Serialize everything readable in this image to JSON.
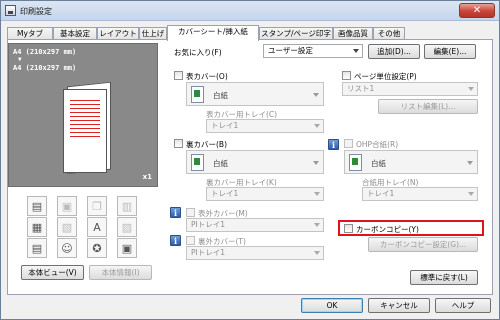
{
  "window": {
    "title": "印刷設定",
    "close_label": "✕"
  },
  "tabs": [
    "Myタブ",
    "基本設定",
    "レイアウト",
    "仕上げ",
    "カバーシート/挿入紙",
    "スタンプ/ページ印字",
    "画像品質",
    "その他"
  ],
  "active_tab": "カバーシート/挿入紙",
  "favorites": {
    "label": "お気に入り(F)",
    "value": "ユーザー設定",
    "add_label": "追加(D)...",
    "edit_label": "編集(E)..."
  },
  "preview": {
    "size_line1": "A4 (210x297 mm)",
    "arrow": "▼",
    "size_line2": "A4 (210x297 mm)",
    "copies": "x1"
  },
  "left_buttons": {
    "printer_view": "本体ビュー(V)",
    "printer_info": "本体情報(I)"
  },
  "front_cover": {
    "label": "表カバー(O)",
    "paper": "白紙",
    "tray_label": "表カバー用トレイ(C)",
    "tray": "トレイ1"
  },
  "back_cover": {
    "label": "裏カバー(B)",
    "paper": "白紙",
    "tray_label": "裏カバー用トレイ(K)",
    "tray": "トレイ1"
  },
  "front_outer": {
    "label": "表外カバー(M)",
    "tray": "PIトレイ1"
  },
  "back_outer": {
    "label": "裏外カバー(T)",
    "tray": "PIトレイ1"
  },
  "per_page": {
    "label": "ページ単位設定(P)",
    "list": "リスト1",
    "list_edit": "リスト編集(L)..."
  },
  "ohp": {
    "label": "OHP合紙(R)",
    "paper": "白紙",
    "tray_label": "合紙用トレイ(N)",
    "tray": "トレイ1"
  },
  "carbon": {
    "label": "カーボンコピー(Y)",
    "settings": "カーボンコピー設定(G)..."
  },
  "reset_label": "標準に戻す(L)",
  "footer": {
    "ok": "OK",
    "cancel": "キャンセル",
    "help": "ヘルプ"
  },
  "colors": {
    "highlight": "#e0121d",
    "preview_bg": "#898989"
  }
}
